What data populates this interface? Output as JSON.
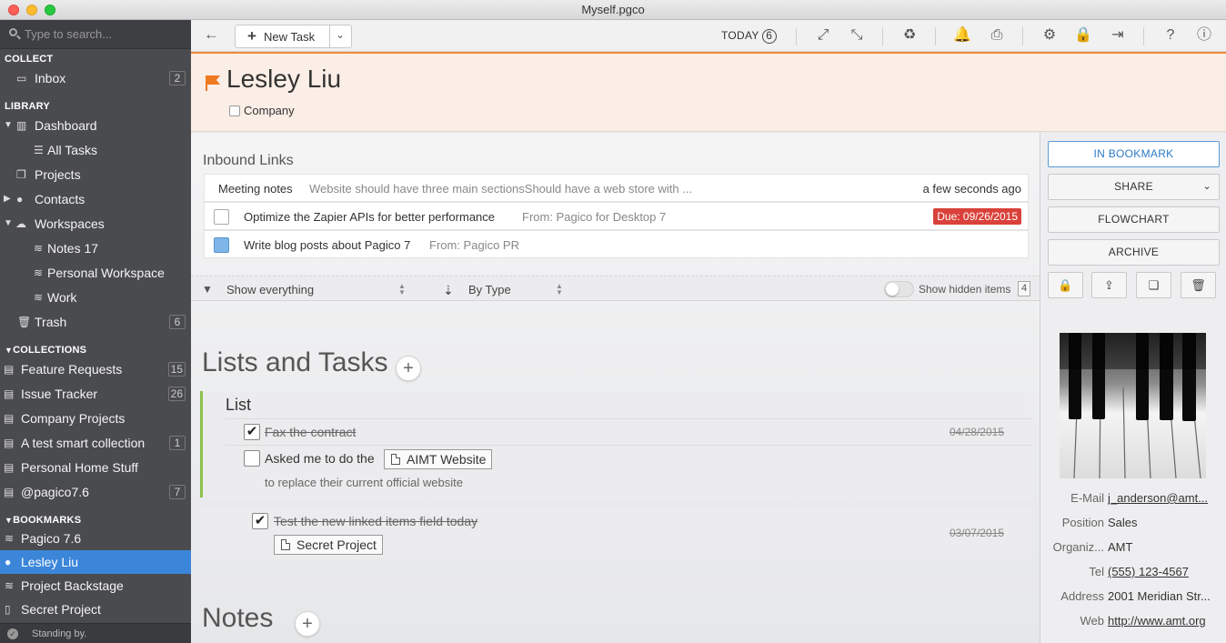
{
  "window": {
    "title": "Myself.pgco"
  },
  "sidebar": {
    "search_placeholder": "Type to search...",
    "sections": {
      "collect": "COLLECT",
      "library": "LIBRARY",
      "collections": "COLLECTIONS",
      "bookmarks": "BOOKMARKS"
    },
    "collect": [
      {
        "label": "Inbox",
        "count": "2"
      }
    ],
    "library": [
      {
        "label": "Dashboard"
      },
      {
        "label": "All Tasks"
      },
      {
        "label": "Projects"
      },
      {
        "label": "Contacts"
      },
      {
        "label": "Workspaces"
      },
      {
        "label": "Notes 17"
      },
      {
        "label": "Personal Workspace"
      },
      {
        "label": "Work"
      },
      {
        "label": "Trash",
        "count": "6"
      }
    ],
    "collections": [
      {
        "label": "Feature Requests",
        "count": "15"
      },
      {
        "label": "Issue Tracker",
        "count": "26"
      },
      {
        "label": "Company Projects"
      },
      {
        "label": "A test smart collection",
        "count": "1"
      },
      {
        "label": "Personal Home Stuff"
      },
      {
        "label": "@pagico7.6",
        "count": "7"
      }
    ],
    "bookmarks": [
      {
        "label": "Pagico 7.6"
      },
      {
        "label": "Lesley Liu",
        "active": true
      },
      {
        "label": "Project Backstage"
      },
      {
        "label": "Secret Project"
      }
    ],
    "status": "Standing by."
  },
  "toolbar": {
    "new_task": "New Task",
    "today_label": "TODAY",
    "today_count": "6",
    "icons": [
      "expand-icon",
      "collapse-icon",
      "recycle-icon",
      "bell-icon",
      "print-icon",
      "gear-icon",
      "lock-icon",
      "logout-icon",
      "help-icon",
      "info-icon"
    ]
  },
  "header": {
    "name": "Lesley Liu",
    "company_label": "Company",
    "flag_color": "#f07a22"
  },
  "inbound": {
    "title": "Inbound Links",
    "rows": [
      {
        "title": "Meeting notes",
        "detail": "Website should have three main sectionsShould have a web store with ...",
        "meta": "a few seconds ago"
      },
      {
        "title": "Optimize the Zapier APIs for better performance",
        "detail": "From: Pagico for Desktop 7",
        "due": "Due: 09/26/2015"
      },
      {
        "title": "Write blog posts about Pagico 7",
        "detail": "From: Pagico PR"
      }
    ]
  },
  "filter": {
    "show": "Show everything",
    "sort": "By Type",
    "hidden_label": "Show hidden items",
    "hidden_count": "4"
  },
  "lists": {
    "title": "Lists and Tasks",
    "list_name": "List",
    "tasks": [
      {
        "text": "Fax the contract",
        "done": true,
        "date": "04/28/2015"
      },
      {
        "text": "Asked me to do the",
        "chip": "AIMT Website",
        "sub": "to replace their current official website",
        "done": false
      }
    ],
    "standalone": {
      "text": "Test the new linked items field today",
      "done": true,
      "date": "03/07/2015",
      "chip": "Secret Project"
    }
  },
  "notes": {
    "title": "Notes"
  },
  "rightpane": {
    "buttons": {
      "bookmark": "IN BOOKMARK",
      "share": "SHARE",
      "flowchart": "FLOWCHART",
      "archive": "ARCHIVE"
    },
    "details": [
      {
        "key": "E-Mail",
        "value": "j_anderson@amt...",
        "link": true
      },
      {
        "key": "Position",
        "value": "Sales"
      },
      {
        "key": "Organiz...",
        "value": "AMT"
      },
      {
        "key": "Tel",
        "value": "(555) 123-4567",
        "link": true
      },
      {
        "key": "Address",
        "value": "2001 Meridian Str..."
      },
      {
        "key": "Web",
        "value": "http://www.amt.org",
        "link": true
      }
    ]
  },
  "colors": {
    "accent": "#3b86d9",
    "header_bg": "#fbeee6",
    "header_border": "#f08a3c",
    "due_red": "#d9413a",
    "list_green": "#8ec04d"
  }
}
